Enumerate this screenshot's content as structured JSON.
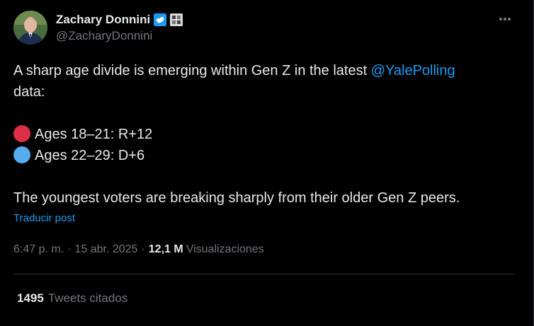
{
  "author": {
    "display_name": "Zachary Donnini",
    "handle": "@ZacharyDonnini",
    "verified": true,
    "avatar_icon": "profile-photo"
  },
  "tweet": {
    "text_line1_prefix": "A sharp age divide is emerging within Gen Z in the latest ",
    "mention": "@YalePolling",
    "text_line2": "data:",
    "item1": {
      "emoji": "red-circle",
      "color": "#dd2e44",
      "text": "Ages 18–21: R+12"
    },
    "item2": {
      "emoji": "blue-circle",
      "color": "#55acee",
      "text": "Ages 22–29: D+6"
    },
    "closing": "The youngest voters are breaking sharply from their older Gen Z peers."
  },
  "translate_label": "Traducir post",
  "meta": {
    "time": "6:47 p. m.",
    "separator": "·",
    "date": "15 abr. 2025",
    "views_count": "12,1 M",
    "views_label": "Visualizaciones"
  },
  "quotes": {
    "count": "1495",
    "label": "Tweets citados"
  },
  "colors": {
    "background": "#000000",
    "text": "#e7e9ea",
    "muted": "#71767b",
    "link": "#1d9bf0",
    "verified": "#1d9bf0"
  }
}
